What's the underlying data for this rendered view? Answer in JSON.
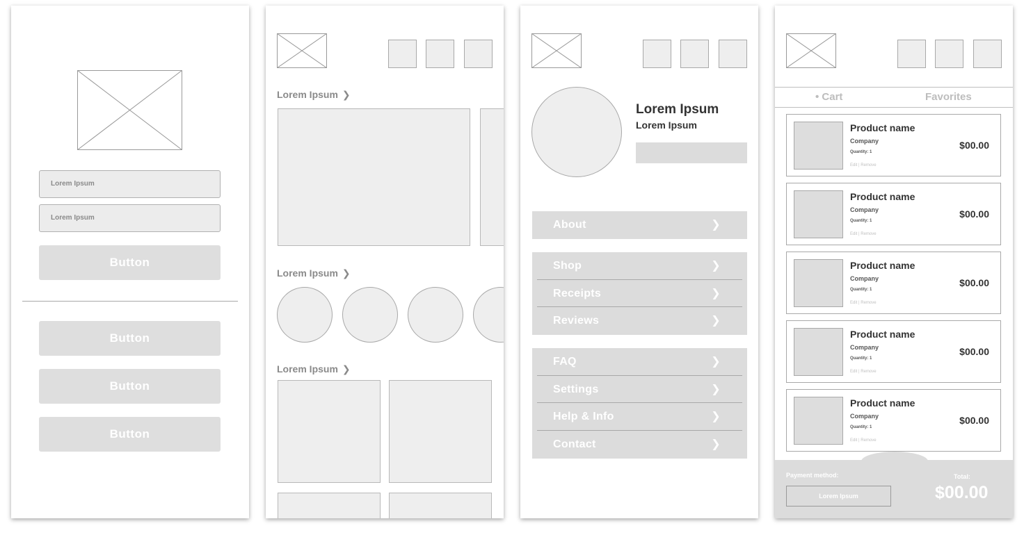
{
  "login": {
    "field1_text": "Lorem Ipsum",
    "field2_text": "Lorem Ipsum",
    "primary_button": "Button",
    "buttons": [
      "Button",
      "Button",
      "Button"
    ]
  },
  "home": {
    "sections": [
      {
        "title": "Lorem Ipsum",
        "chevron": "❯"
      },
      {
        "title": "Lorem Ipsum",
        "chevron": "❯"
      },
      {
        "title": "Lorem Ipsum",
        "chevron": "❯"
      }
    ]
  },
  "profile": {
    "name": "Lorem Ipsum",
    "subtitle": "Lorem Ipsum",
    "chevron": "❯",
    "menu_group_1": [
      "About"
    ],
    "menu_group_2": [
      "Shop",
      "Receipts",
      "Reviews"
    ],
    "menu_group_3": [
      "FAQ",
      "Settings",
      "Help & Info",
      "Contact"
    ]
  },
  "cart": {
    "tabs": {
      "cart": "• Cart",
      "favorites": "Favorites"
    },
    "items": [
      {
        "name": "Product name",
        "company": "Company",
        "quantity": "Quantity: 1",
        "edit": "Edit",
        "remove": "Remove",
        "price": "$00.00"
      },
      {
        "name": "Product name",
        "company": "Company",
        "quantity": "Quantity: 1",
        "edit": "Edit",
        "remove": "Remove",
        "price": "$00.00"
      },
      {
        "name": "Product name",
        "company": "Company",
        "quantity": "Quantity: 1",
        "edit": "Edit",
        "remove": "Remove",
        "price": "$00.00"
      },
      {
        "name": "Product name",
        "company": "Company",
        "quantity": "Quantity: 1",
        "edit": "Edit",
        "remove": "Remove",
        "price": "$00.00"
      },
      {
        "name": "Product name",
        "company": "Company",
        "quantity": "Quantity: 1",
        "edit": "Edit",
        "remove": "Remove",
        "price": "$00.00"
      }
    ],
    "payment_label": "Payment method:",
    "payment_value": "Lorem Ipsum",
    "total_label": "Total:",
    "total_value": "$00.00"
  },
  "colors": {
    "placeholder_fill": "#eeeeee",
    "button_fill": "#dedede",
    "border": "#a8a8a8",
    "text_gray": "#8a8a8a",
    "text_dark": "#333333"
  },
  "icons": {
    "image_placeholder": "image-placeholder-icon",
    "chevron": "chevron-right-icon",
    "header_buttons": "header-button-icon"
  }
}
